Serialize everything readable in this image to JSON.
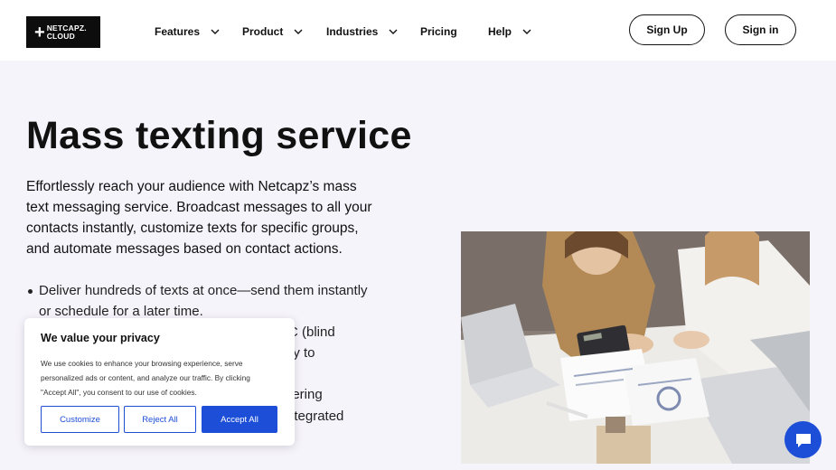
{
  "header": {
    "logo": {
      "line1": "NETCAPZ.",
      "line2": "CLOUD"
    },
    "nav": [
      {
        "label": "Features"
      },
      {
        "label": "Product"
      },
      {
        "label": "Industries"
      },
      {
        "label": "Pricing"
      },
      {
        "label": "Help"
      }
    ],
    "signup_label": "Sign Up",
    "signin_label": "Sign in"
  },
  "hero": {
    "title": "Mass texting service",
    "description": "Effortlessly reach your audience with Netcapz’s mass text messaging service. Broadcast messages to all your contacts instantly, customize texts for specific groups, and automate messages based on contact actions.",
    "bullets": [
      "Deliver hundreds of texts at once—send them instantly or schedule for a later time."
    ],
    "bullet_fragments": [
      "C (blind",
      "ery to",
      "gering",
      "ntegrated"
    ]
  },
  "cookie": {
    "title": "We value your privacy",
    "text": "We use cookies to enhance your browsing experience, serve personalized ads or content, and analyze our traffic. By clicking \"Accept All\", you consent to our use of cookies.",
    "customize_label": "Customize",
    "reject_label": "Reject All",
    "accept_label": "Accept All"
  },
  "colors": {
    "accent": "#1d4ed8",
    "page_bg": "#f6f4fb",
    "header_bg": "#ffffff",
    "logo_bg": "#0d0d0d"
  },
  "icons": {
    "chevron": "chevron-down-icon",
    "chat": "chat-bubble-icon"
  }
}
